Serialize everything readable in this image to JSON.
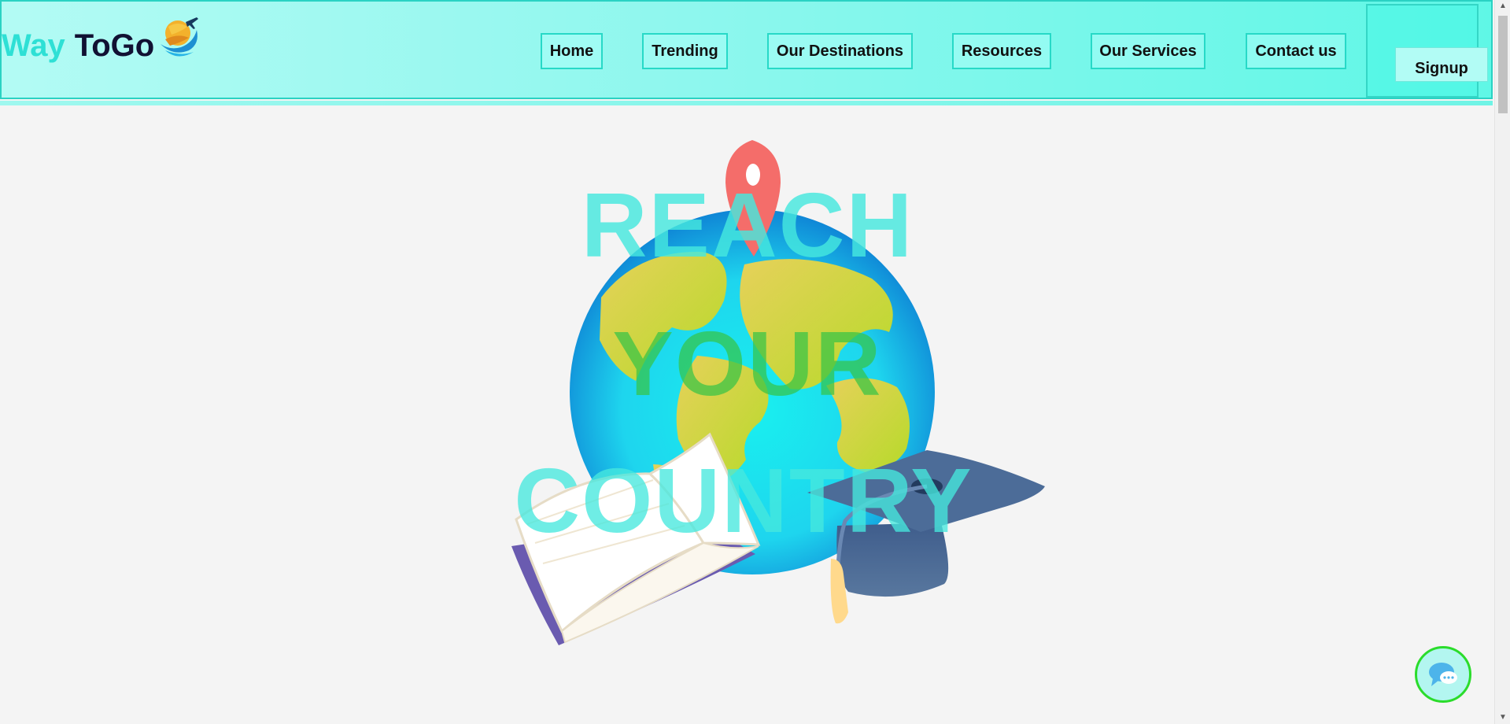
{
  "brand": {
    "word1": "Way",
    "word2": "ToGo",
    "icon": "plane-globe-logo-icon"
  },
  "nav": {
    "items": [
      {
        "label": "Home"
      },
      {
        "label": "Trending"
      },
      {
        "label": "Our Destinations"
      },
      {
        "label": "Resources"
      },
      {
        "label": "Our Services"
      },
      {
        "label": "Contact us"
      }
    ],
    "signup_label": "Signup"
  },
  "hero": {
    "line1": "REACH",
    "line2": "YOUR",
    "line3": "COUNTRY",
    "illustration": "globe-book-graduation-cap",
    "icons": [
      "location-pin-icon",
      "globe-icon",
      "book-icon",
      "graduation-cap-icon"
    ]
  },
  "chat": {
    "icon": "chat-bubble-icon"
  },
  "colors": {
    "accent": "#2ee0d5",
    "header_bg": "#8ff7ee",
    "brand_dark": "#111133",
    "hero_text_cyan": "#46e8de",
    "hero_text_green": "#36c446",
    "chat_border": "#2bdc2b"
  }
}
